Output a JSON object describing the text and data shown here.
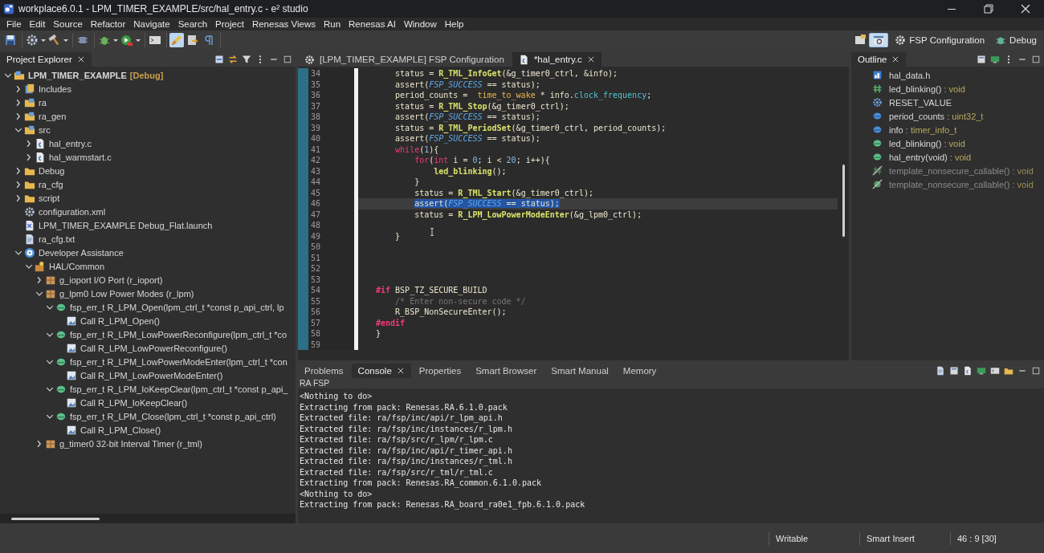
{
  "window": {
    "title": "workplace6.0.1 - LPM_TIMER_EXAMPLE/src/hal_entry.c - e² studio"
  },
  "menu": [
    "File",
    "Edit",
    "Source",
    "Refactor",
    "Navigate",
    "Search",
    "Project",
    "Renesas Views",
    "Run",
    "Renesas AI",
    "Window",
    "Help"
  ],
  "toolbar_groups": [
    [
      {
        "kind": "save",
        "selected": false,
        "dropdown": false
      }
    ],
    [
      {
        "kind": "gear",
        "selected": false,
        "dropdown": true
      },
      {
        "kind": "hammer",
        "selected": false,
        "dropdown": true
      }
    ],
    [
      {
        "kind": "chip",
        "selected": false,
        "dropdown": false
      }
    ],
    [
      {
        "kind": "bug",
        "selected": false,
        "dropdown": true
      },
      {
        "kind": "run",
        "selected": false,
        "dropdown": true
      }
    ],
    [
      {
        "kind": "console",
        "selected": false,
        "dropdown": false
      }
    ],
    [
      {
        "kind": "brush",
        "selected": true,
        "dropdown": false
      },
      {
        "kind": "next",
        "selected": false,
        "dropdown": false
      },
      {
        "kind": "pilcrow",
        "selected": false,
        "dropdown": false
      }
    ]
  ],
  "perspectives": [
    {
      "kind": "cpp",
      "selected": true
    },
    {
      "kind": "fsp",
      "label": "FSP Configuration",
      "selected": false
    },
    {
      "kind": "debug",
      "label": "Debug",
      "selected": false
    }
  ],
  "project_explorer": {
    "tab": "Project Explorer",
    "tree": [
      {
        "kind": "project",
        "label": "LPM_TIMER_EXAMPLE",
        "tag": "[Debug]",
        "expanded": true,
        "children": [
          {
            "kind": "includes",
            "label": "Includes",
            "expanded": false
          },
          {
            "kind": "srcfolder",
            "label": "ra",
            "expanded": false
          },
          {
            "kind": "srcfolder",
            "label": "ra_gen",
            "expanded": false
          },
          {
            "kind": "srcfolder",
            "label": "src",
            "expanded": true,
            "children": [
              {
                "kind": "cfile",
                "label": "hal_entry.c",
                "expanded": false
              },
              {
                "kind": "cfile",
                "label": "hal_warmstart.c",
                "expanded": false
              }
            ]
          },
          {
            "kind": "folder",
            "label": "Debug",
            "expanded": false
          },
          {
            "kind": "folder",
            "label": "ra_cfg",
            "expanded": false
          },
          {
            "kind": "folder",
            "label": "script",
            "expanded": false
          },
          {
            "kind": "gear",
            "label": "configuration.xml"
          },
          {
            "kind": "launch",
            "label": "LPM_TIMER_EXAMPLE Debug_Flat.launch"
          },
          {
            "kind": "text",
            "label": "ra_cfg.txt"
          },
          {
            "kind": "help",
            "label": "Developer Assistance",
            "expanded": true,
            "children": [
              {
                "kind": "hal",
                "label": "HAL/Common",
                "expanded": true,
                "children": [
                  {
                    "kind": "module",
                    "label": "g_ioport I/O Port (r_ioport)",
                    "expanded": false
                  },
                  {
                    "kind": "module",
                    "label": "g_lpm0 Low Power Modes (r_lpm)",
                    "expanded": true,
                    "children": [
                      {
                        "kind": "function",
                        "label": "fsp_err_t R_LPM_Open(lpm_ctrl_t *const p_api_ctrl, lp",
                        "expanded": true,
                        "children": [
                          {
                            "kind": "call",
                            "label": "Call R_LPM_Open()"
                          }
                        ]
                      },
                      {
                        "kind": "function",
                        "label": "fsp_err_t R_LPM_LowPowerReconfigure(lpm_ctrl_t *co",
                        "expanded": true,
                        "children": [
                          {
                            "kind": "call",
                            "label": "Call R_LPM_LowPowerReconfigure()"
                          }
                        ]
                      },
                      {
                        "kind": "function",
                        "label": "fsp_err_t R_LPM_LowPowerModeEnter(lpm_ctrl_t *con",
                        "expanded": true,
                        "children": [
                          {
                            "kind": "call",
                            "label": "Call R_LPM_LowPowerModeEnter()"
                          }
                        ]
                      },
                      {
                        "kind": "function",
                        "label": "fsp_err_t R_LPM_IoKeepClear(lpm_ctrl_t *const p_api_",
                        "expanded": true,
                        "children": [
                          {
                            "kind": "call",
                            "label": "Call R_LPM_IoKeepClear()"
                          }
                        ]
                      },
                      {
                        "kind": "function",
                        "label": "fsp_err_t R_LPM_Close(lpm_ctrl_t *const p_api_ctrl)",
                        "expanded": true,
                        "children": [
                          {
                            "kind": "call",
                            "label": "Call R_LPM_Close()"
                          }
                        ]
                      }
                    ]
                  },
                  {
                    "kind": "module",
                    "label": "g_timer0 32-bit Interval Timer (r_tml)",
                    "expanded": false
                  }
                ]
              }
            ]
          }
        ]
      }
    ]
  },
  "editor": {
    "tabs": [
      {
        "kind": "fsp",
        "label": "[LPM_TIMER_EXAMPLE] FSP Configuration",
        "selected": false
      },
      {
        "kind": "cfile",
        "label": "*hal_entry.c",
        "selected": true
      }
    ],
    "lines": [
      {
        "number": "34",
        "selected": false,
        "tokens": [
          {
            "kind": "plain",
            "text": "    status = "
          },
          {
            "kind": "func",
            "text": "R_TML_InfoGet"
          },
          {
            "kind": "plain",
            "text": "(&g_timer0_ctrl, &info);"
          }
        ]
      },
      {
        "number": "35",
        "selected": false,
        "tokens": [
          {
            "kind": "plain",
            "text": "    assert("
          },
          {
            "kind": "macro",
            "text": "FSP_SUCCESS"
          },
          {
            "kind": "plain",
            "text": " == status);"
          }
        ]
      },
      {
        "number": "36",
        "selected": false,
        "tokens": [
          {
            "kind": "plain",
            "text": "    period_counts =  "
          },
          {
            "kind": "global",
            "text": "time_to_wake"
          },
          {
            "kind": "plain",
            "text": " * info."
          },
          {
            "kind": "field",
            "text": "clock_frequency"
          },
          {
            "kind": "plain",
            "text": ";"
          }
        ]
      },
      {
        "number": "37",
        "selected": false,
        "tokens": [
          {
            "kind": "plain",
            "text": "    status = "
          },
          {
            "kind": "func",
            "text": "R_TML_Stop"
          },
          {
            "kind": "plain",
            "text": "(&g_timer0_ctrl);"
          }
        ]
      },
      {
        "number": "38",
        "selected": false,
        "tokens": [
          {
            "kind": "plain",
            "text": "    assert("
          },
          {
            "kind": "macro",
            "text": "FSP_SUCCESS"
          },
          {
            "kind": "plain",
            "text": " == status);"
          }
        ]
      },
      {
        "number": "39",
        "selected": false,
        "tokens": [
          {
            "kind": "plain",
            "text": "    status = "
          },
          {
            "kind": "func",
            "text": "R_TML_PeriodSet"
          },
          {
            "kind": "plain",
            "text": "(&g_timer0_ctrl, period_counts);"
          }
        ]
      },
      {
        "number": "40",
        "selected": false,
        "tokens": [
          {
            "kind": "plain",
            "text": "    assert("
          },
          {
            "kind": "macro",
            "text": "FSP_SUCCESS"
          },
          {
            "kind": "plain",
            "text": " == status);"
          }
        ]
      },
      {
        "number": "41",
        "selected": false,
        "tokens": [
          {
            "kind": "keyword",
            "text": "    while"
          },
          {
            "kind": "plain",
            "text": "("
          },
          {
            "kind": "number",
            "text": "1"
          },
          {
            "kind": "plain",
            "text": "){"
          }
        ]
      },
      {
        "number": "42",
        "selected": false,
        "tokens": [
          {
            "kind": "keyword",
            "text": "        for"
          },
          {
            "kind": "plain",
            "text": "("
          },
          {
            "kind": "keyword",
            "text": "int"
          },
          {
            "kind": "plain",
            "text": " i = "
          },
          {
            "kind": "number",
            "text": "0"
          },
          {
            "kind": "plain",
            "text": "; i < "
          },
          {
            "kind": "number",
            "text": "20"
          },
          {
            "kind": "plain",
            "text": "; i++){"
          }
        ]
      },
      {
        "number": "43",
        "selected": false,
        "tokens": [
          {
            "kind": "func",
            "text": "            led_blinking"
          },
          {
            "kind": "plain",
            "text": "();"
          }
        ]
      },
      {
        "number": "44",
        "selected": false,
        "tokens": [
          {
            "kind": "plain",
            "text": "        }"
          }
        ]
      },
      {
        "number": "45",
        "selected": false,
        "tokens": [
          {
            "kind": "plain",
            "text": "        status = "
          },
          {
            "kind": "func",
            "text": "R_TML_Start"
          },
          {
            "kind": "plain",
            "text": "(&g_timer0_ctrl);"
          }
        ]
      },
      {
        "number": "46",
        "selected": true,
        "tokens": [
          {
            "kind": "plain",
            "text": "        assert("
          },
          {
            "kind": "macro",
            "text": "FSP_SUCCESS"
          },
          {
            "kind": "plain",
            "text": " == status);"
          }
        ]
      },
      {
        "number": "47",
        "selected": false,
        "tokens": [
          {
            "kind": "plain",
            "text": "        status = "
          },
          {
            "kind": "func",
            "text": "R_LPM_LowPowerModeEnter"
          },
          {
            "kind": "plain",
            "text": "(&g_lpm0_ctrl);"
          }
        ]
      },
      {
        "number": "48",
        "selected": false
      },
      {
        "number": "49",
        "selected": false,
        "tokens": [
          {
            "kind": "plain",
            "text": "    }"
          }
        ]
      },
      {
        "number": "50",
        "selected": false
      },
      {
        "number": "51",
        "selected": false
      },
      {
        "number": "52",
        "selected": false
      },
      {
        "number": "53",
        "selected": false
      },
      {
        "number": "54",
        "selected": false,
        "tokens": [
          {
            "kind": "directive",
            "text": "#if"
          },
          {
            "kind": "plain",
            "text": " BSP_TZ_SECURE_BUILD"
          }
        ]
      },
      {
        "number": "55",
        "selected": false,
        "tokens": [
          {
            "kind": "comment",
            "text": "    /* Enter non-secure code */"
          }
        ]
      },
      {
        "number": "56",
        "selected": false,
        "tokens": [
          {
            "kind": "plain",
            "text": "    R_BSP_NonSecureEnter();"
          }
        ]
      },
      {
        "number": "57",
        "selected": false,
        "tokens": [
          {
            "kind": "directive",
            "text": "#endif"
          }
        ]
      },
      {
        "number": "58",
        "selected": false,
        "tokens": [
          {
            "kind": "plain",
            "text": "}"
          }
        ]
      },
      {
        "number": "59",
        "selected": false
      }
    ]
  },
  "outline": {
    "tab": "Outline",
    "items": [
      {
        "kind": "header",
        "name": "hal_data.h",
        "disabled": false
      },
      {
        "kind": "hash",
        "name": "led_blinking()",
        "type": " : void",
        "disabled": false
      },
      {
        "kind": "macro",
        "name": "RESET_VALUE",
        "disabled": false
      },
      {
        "kind": "variable",
        "name": "period_counts",
        "type": " : uint32_t",
        "disabled": false
      },
      {
        "kind": "variable",
        "name": "info",
        "type": " : timer_info_t",
        "disabled": false
      },
      {
        "kind": "function",
        "name": "led_blinking()",
        "type": " : void",
        "disabled": false
      },
      {
        "kind": "function",
        "name": "hal_entry(void)",
        "type": " : void",
        "disabled": false
      },
      {
        "kind": "callable",
        "name": "template_nonsecure_callable()",
        "type": " : void",
        "disabled": true
      },
      {
        "kind": "callable2",
        "name": "template_nonsecure_callable()",
        "type": " : void",
        "disabled": true
      }
    ]
  },
  "bottom_panel": {
    "tabs": [
      {
        "label": "Problems",
        "selected": false
      },
      {
        "label": "Console",
        "selected": true
      },
      {
        "label": "Properties",
        "selected": false
      },
      {
        "label": "Smart Browser",
        "selected": false
      },
      {
        "label": "Smart Manual",
        "selected": false
      },
      {
        "label": "Memory",
        "selected": false
      }
    ],
    "console_title": "RA FSP",
    "console_lines": [
      "<Nothing to do>",
      "Extracting from pack: Renesas.RA.6.1.0.pack",
      "Extracted file: ra/fsp/inc/api/r_lpm_api.h",
      "Extracted file: ra/fsp/inc/instances/r_lpm.h",
      "Extracted file: ra/fsp/src/r_lpm/r_lpm.c",
      "Extracted file: ra/fsp/inc/api/r_timer_api.h",
      "Extracted file: ra/fsp/inc/instances/r_tml.h",
      "Extracted file: ra/fsp/src/r_tml/r_tml.c",
      "Extracting from pack: Renesas.RA_common.6.1.0.pack",
      "<Nothing to do>",
      "Extracting from pack: Renesas.RA_board_ra0e1_fpb.6.1.0.pack"
    ]
  },
  "status_bar": [
    "Writable",
    "Smart Insert",
    "46 : 9 [30]"
  ]
}
